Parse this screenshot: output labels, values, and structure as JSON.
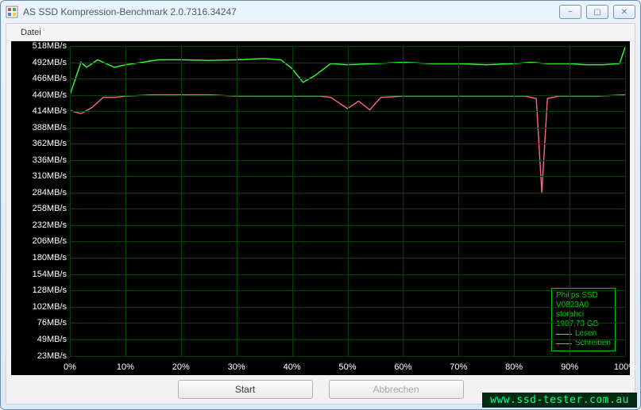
{
  "window": {
    "title": "AS SSD Kompression-Benchmark 2.0.7316.34247",
    "minimize_icon": "−",
    "maximize_icon": "▢",
    "close_icon": "✕"
  },
  "menu": {
    "file": "Datei"
  },
  "buttons": {
    "start": "Start",
    "cancel": "Abbrechen"
  },
  "legend": {
    "line1": "Philips SSD",
    "line2": "V0823A0",
    "line3": "storahci",
    "line4": "1907,73 GB",
    "read": "Lesen",
    "write": "Schreiben",
    "read_color": "#33ff33",
    "write_color": "#ff6688"
  },
  "watermark": "www.ssd-tester.com.au",
  "chart_data": {
    "type": "line",
    "title": "",
    "xlabel": "",
    "ylabel": "",
    "y_unit": "MB/s",
    "ylim": [
      23,
      518
    ],
    "xlim": [
      0,
      100
    ],
    "y_ticks": [
      23,
      49,
      76,
      102,
      128,
      154,
      180,
      206,
      232,
      258,
      284,
      310,
      336,
      362,
      388,
      414,
      440,
      466,
      492,
      518
    ],
    "x_ticks": [
      0,
      10,
      20,
      30,
      40,
      50,
      60,
      70,
      80,
      90,
      100
    ],
    "x_tick_labels": [
      "0%",
      "10%",
      "20%",
      "30%",
      "40%",
      "50%",
      "60%",
      "70%",
      "80%",
      "90%",
      "100%"
    ],
    "series": [
      {
        "name": "Lesen",
        "color": "#33ff33",
        "x": [
          0,
          2,
          3,
          5,
          8,
          10,
          13,
          16,
          20,
          25,
          30,
          35,
          38,
          40,
          42,
          44,
          47,
          50,
          55,
          60,
          65,
          70,
          75,
          80,
          83,
          86,
          88,
          90,
          93,
          96,
          99,
          100
        ],
        "values": [
          440,
          492,
          484,
          496,
          484,
          488,
          492,
          496,
          496,
          495,
          496,
          498,
          496,
          482,
          460,
          470,
          490,
          488,
          490,
          492,
          490,
          490,
          488,
          490,
          492,
          490,
          490,
          490,
          488,
          488,
          490,
          516
        ]
      },
      {
        "name": "Schreiben",
        "color": "#ff6688",
        "x": [
          0,
          2,
          4,
          6,
          8,
          10,
          15,
          20,
          25,
          30,
          35,
          40,
          45,
          47,
          50,
          52,
          54,
          56,
          60,
          65,
          70,
          75,
          80,
          82,
          84,
          85,
          86,
          88,
          90,
          95,
          100
        ],
        "values": [
          415,
          410,
          420,
          436,
          436,
          438,
          440,
          440,
          440,
          438,
          438,
          438,
          438,
          436,
          418,
          430,
          416,
          436,
          438,
          438,
          438,
          438,
          438,
          438,
          434,
          284,
          434,
          438,
          438,
          438,
          440
        ]
      }
    ]
  }
}
